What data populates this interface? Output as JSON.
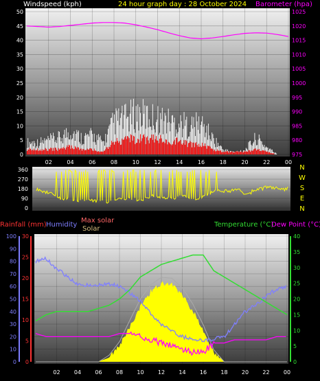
{
  "header": {
    "title": "24 hour graph day : 28 October 2024",
    "wind_label": "Windspeed (kph)",
    "baro_label": "Barometer (hpa)"
  },
  "lower_header": {
    "rain_label": "Rainfall (mm)",
    "humidity_label": "Humidity",
    "max_solar_label": "Max solar",
    "solar_label": "Solar",
    "temp_label": "Temperature (°C)",
    "dew_label": "Dew Point (°C)"
  },
  "colors": {
    "wind": "#ff0000",
    "gust": "#ffffff",
    "barometer": "#ff00ff",
    "direction": "#ffff00",
    "rain": "#ff3333",
    "humidity": "#7f7fff",
    "temperature": "#33dd33",
    "dewpoint": "#ff00ff",
    "solar": "#ffff00",
    "max_solar": "#aaaaaa",
    "title": "#ffff00"
  },
  "chart_data": [
    {
      "type": "bar",
      "panel": "wind",
      "x_ticks": [
        "02",
        "04",
        "06",
        "08",
        "10",
        "12",
        "14",
        "16",
        "18",
        "20",
        "22",
        "00"
      ],
      "ylabel": "Windspeed (kph)",
      "ylim": [
        0,
        50
      ],
      "y_ticks": [
        0,
        5,
        10,
        15,
        20,
        25,
        30,
        35,
        40,
        45,
        50
      ],
      "x_hours": [
        0,
        1,
        2,
        3,
        4,
        5,
        6,
        7,
        8,
        9,
        10,
        11,
        12,
        13,
        14,
        15,
        16,
        17,
        18,
        19,
        20,
        21,
        22,
        23,
        24
      ],
      "wind_avg": [
        2,
        2,
        2,
        2,
        3,
        2,
        2,
        1,
        5,
        6,
        6,
        6,
        6,
        5,
        5,
        4,
        4,
        2,
        1,
        1,
        1,
        2,
        1,
        0,
        0
      ],
      "wind_gust": [
        5,
        5,
        6,
        7,
        10,
        7,
        8,
        5,
        14,
        15,
        17,
        16,
        15,
        14,
        13,
        12,
        13,
        7,
        2,
        1,
        2,
        7,
        3,
        0,
        0
      ],
      "y2label": "Barometer (hpa)",
      "y2lim": [
        975,
        1025
      ],
      "y2_ticks": [
        975,
        980,
        985,
        990,
        995,
        1000,
        1005,
        1010,
        1015,
        1020,
        1025
      ],
      "barometer": [
        1020.0,
        1019.8,
        1019.6,
        1019.8,
        1020.2,
        1020.6,
        1021.0,
        1021.2,
        1021.2,
        1021.0,
        1020.4,
        1019.6,
        1018.7,
        1017.6,
        1016.6,
        1015.8,
        1015.5,
        1015.8,
        1016.3,
        1016.9,
        1017.4,
        1017.6,
        1017.5,
        1017.0,
        1016.3
      ]
    },
    {
      "type": "scatter",
      "panel": "direction",
      "ylim": [
        0,
        360
      ],
      "y_ticks": [
        0,
        90,
        180,
        270,
        360
      ],
      "compass": [
        "N",
        "W",
        "S",
        "E",
        "N"
      ],
      "x_hours": [
        0,
        1,
        2,
        3,
        4,
        5,
        6,
        7,
        8,
        9,
        10,
        11,
        12,
        13,
        14,
        15,
        16,
        17,
        18,
        19,
        20,
        21,
        22,
        23,
        24
      ],
      "direction": [
        180,
        150,
        100,
        90,
        70,
        80,
        70,
        60,
        100,
        90,
        80,
        120,
        110,
        90,
        120,
        80,
        110,
        170,
        160,
        170,
        140,
        160,
        190,
        180,
        180
      ]
    },
    {
      "type": "line",
      "panel": "conditions",
      "x_ticks": [
        "02",
        "04",
        "06",
        "08",
        "10",
        "12",
        "14",
        "16",
        "18",
        "20",
        "22",
        "00"
      ],
      "rain_ylim": [
        0,
        30
      ],
      "rain_ticks": [
        0,
        5,
        10,
        15,
        20,
        25,
        30
      ],
      "humidity_ylim": [
        0,
        100
      ],
      "humidity_ticks": [
        0,
        10,
        20,
        30,
        40,
        50,
        60,
        70,
        80,
        90,
        100
      ],
      "temp_ylim": [
        0,
        40
      ],
      "temp_ticks": [
        0,
        5,
        10,
        15,
        20,
        25,
        30,
        35,
        40
      ],
      "x_hours": [
        0,
        1,
        2,
        3,
        4,
        5,
        6,
        7,
        8,
        9,
        10,
        11,
        12,
        13,
        14,
        15,
        16,
        17,
        18,
        19,
        20,
        21,
        22,
        23,
        24
      ],
      "humidity": [
        80,
        82,
        74,
        68,
        62,
        61,
        61,
        62,
        60,
        55,
        48,
        38,
        30,
        24,
        20,
        18,
        17,
        18,
        20,
        30,
        40,
        45,
        52,
        58,
        60
      ],
      "temperature": [
        13,
        15,
        16,
        16,
        16,
        16,
        17,
        18,
        20,
        23,
        27,
        29,
        31,
        32,
        33,
        34,
        34,
        29,
        27,
        25,
        23,
        21,
        19,
        17,
        15
      ],
      "dewpoint": [
        9,
        8,
        8,
        8,
        8,
        8,
        8,
        8,
        9,
        9,
        8,
        7,
        6,
        5,
        4,
        3,
        3,
        6,
        6,
        7,
        7,
        7,
        7,
        8,
        8
      ],
      "solar_pct": [
        0,
        0,
        0,
        0,
        0,
        0,
        0,
        5,
        20,
        45,
        70,
        90,
        100,
        98,
        85,
        65,
        40,
        12,
        0,
        0,
        0,
        0,
        0,
        0,
        0
      ],
      "max_solar_pct": [
        0,
        0,
        0,
        0,
        0,
        0,
        0,
        8,
        25,
        52,
        78,
        96,
        105,
        104,
        92,
        72,
        46,
        15,
        0,
        0,
        0,
        0,
        0,
        0,
        0
      ]
    }
  ]
}
